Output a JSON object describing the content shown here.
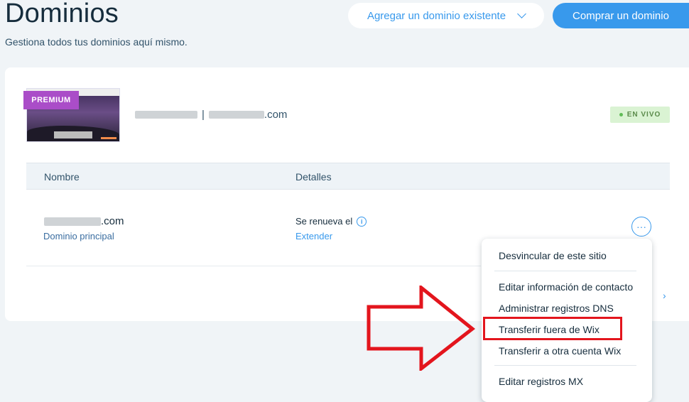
{
  "header": {
    "title": "Dominios",
    "subtitle": "Gestiona todos tus dominios aquí mismo.",
    "add_existing_label": "Agregar un dominio existente",
    "buy_label": "Comprar un dominio"
  },
  "site": {
    "premium_badge": "PREMIUM",
    "domain_suffix": ".com",
    "separator": "|",
    "status": "EN VIVO"
  },
  "table": {
    "col_name": "Nombre",
    "col_details": "Detalles",
    "row": {
      "domain_suffix": ".com",
      "domain_type": "Dominio principal",
      "renew_text": "Se renueva el",
      "extend_link": "Extender",
      "more_icon": "···"
    }
  },
  "menu": {
    "items": [
      "Desvincular de este sitio",
      "Editar información de contacto",
      "Administrar registros DNS",
      "Transferir fuera de Wix",
      "Transferir a otra cuenta Wix",
      "Editar registros MX"
    ]
  },
  "colors": {
    "accent": "#3899ec",
    "premium": "#aa4dc8",
    "live_bg": "#daf3d3",
    "annotation": "#e3151d"
  }
}
